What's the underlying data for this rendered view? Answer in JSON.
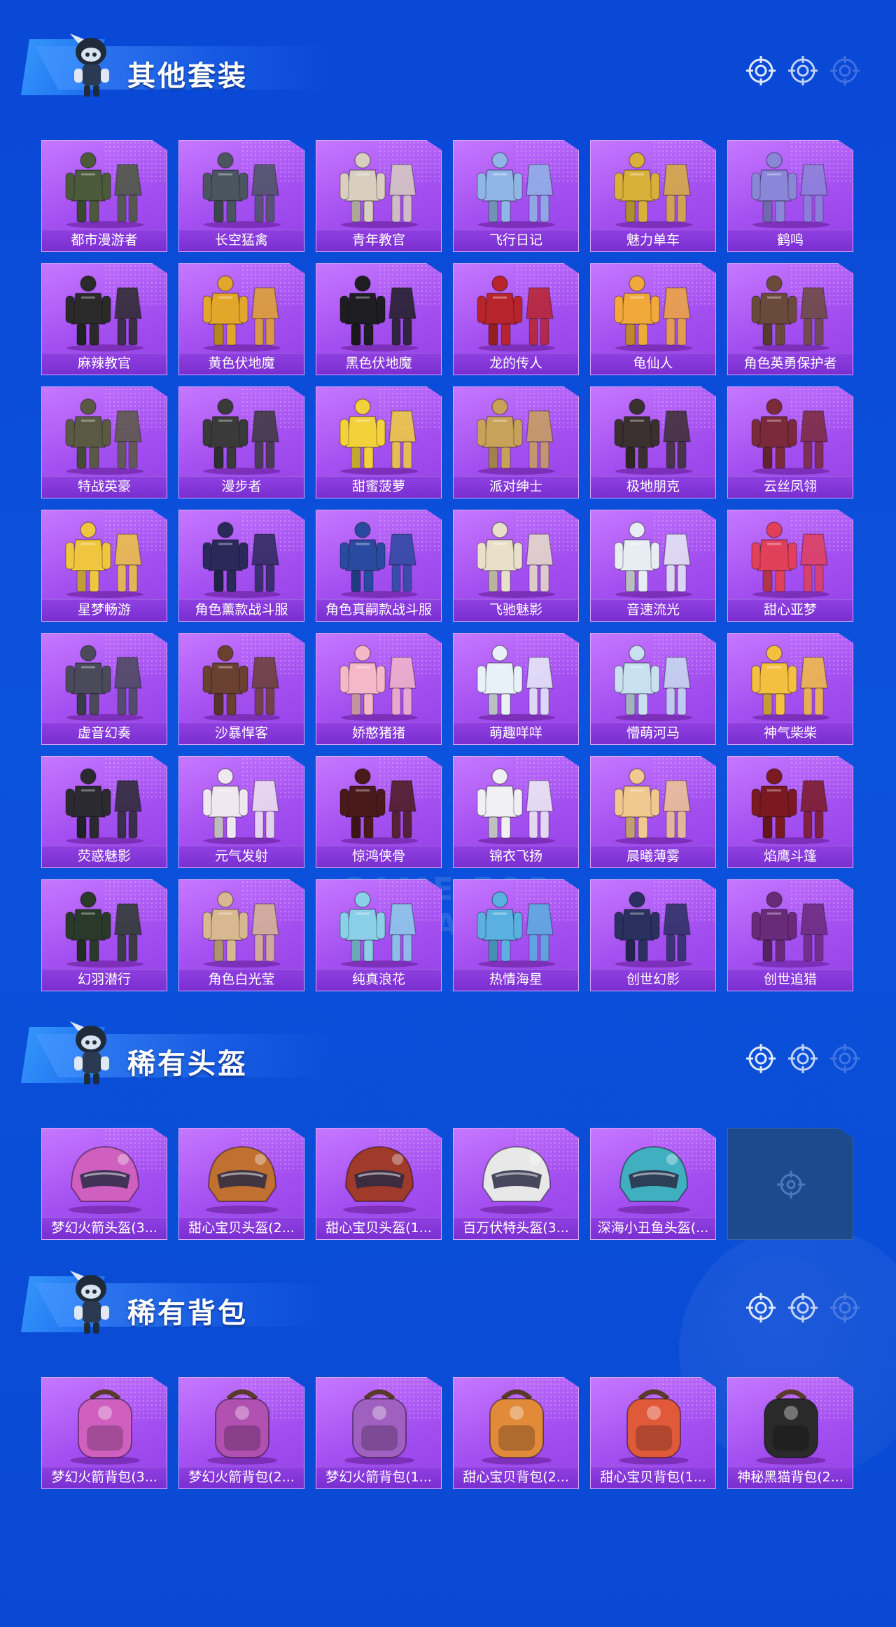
{
  "sections": [
    {
      "title": "其他套装",
      "items": [
        {
          "name": "都市漫游者",
          "kind": "outfit",
          "color": "#4a5a3a"
        },
        {
          "name": "长空猛禽",
          "kind": "outfit",
          "color": "#4b5560"
        },
        {
          "name": "青年教官",
          "kind": "outfit",
          "color": "#d8cfc0"
        },
        {
          "name": "飞行日记",
          "kind": "outfit",
          "color": "#8fb6e6"
        },
        {
          "name": "魅力单车",
          "kind": "outfit",
          "color": "#d9b13a"
        },
        {
          "name": "鹤鸣",
          "kind": "outfit",
          "color": "#8a86d8"
        },
        {
          "name": "麻辣教官",
          "kind": "outfit",
          "color": "#2a2a2a"
        },
        {
          "name": "黄色伏地魔",
          "kind": "outfit",
          "color": "#e2a62a"
        },
        {
          "name": "黑色伏地魔",
          "kind": "outfit",
          "color": "#1e1e22"
        },
        {
          "name": "龙的传人",
          "kind": "outfit",
          "color": "#b8242c"
        },
        {
          "name": "龟仙人",
          "kind": "outfit",
          "color": "#f0a93a"
        },
        {
          "name": "角色英勇保护者",
          "kind": "outfit",
          "color": "#6a4a3a"
        },
        {
          "name": "特战英豪",
          "kind": "outfit",
          "color": "#5a5a44"
        },
        {
          "name": "漫步者",
          "kind": "outfit",
          "color": "#3a3a3a"
        },
        {
          "name": "甜蜜菠萝",
          "kind": "outfit",
          "color": "#f2d13a"
        },
        {
          "name": "派对绅士",
          "kind": "outfit",
          "color": "#c9a25a"
        },
        {
          "name": "极地朋克",
          "kind": "outfit",
          "color": "#3a3030"
        },
        {
          "name": "云丝凤翎",
          "kind": "outfit",
          "color": "#7a2a3a"
        },
        {
          "name": "星梦畅游",
          "kind": "outfit",
          "color": "#f0c640"
        },
        {
          "name": "角色薰款战斗服",
          "kind": "outfit",
          "color": "#2a2a5a"
        },
        {
          "name": "角色真嗣款战斗服",
          "kind": "outfit",
          "color": "#2a4aa0"
        },
        {
          "name": "飞驰魅影",
          "kind": "outfit",
          "color": "#e8e0c8"
        },
        {
          "name": "音速流光",
          "kind": "outfit",
          "color": "#e6eef4"
        },
        {
          "name": "甜心亚梦",
          "kind": "outfit",
          "color": "#e0405a"
        },
        {
          "name": "虚音幻奏",
          "kind": "outfit",
          "color": "#4a4a5a"
        },
        {
          "name": "沙暴悍客",
          "kind": "outfit",
          "color": "#6a4030"
        },
        {
          "name": "娇憨猪猪",
          "kind": "outfit",
          "color": "#f4b8c8"
        },
        {
          "name": "萌趣咩咩",
          "kind": "outfit",
          "color": "#e8f0f8"
        },
        {
          "name": "懵萌河马",
          "kind": "outfit",
          "color": "#c8e0f0"
        },
        {
          "name": "神气柴柴",
          "kind": "outfit",
          "color": "#f4c040"
        },
        {
          "name": "荧惑魅影",
          "kind": "outfit",
          "color": "#2a2a30"
        },
        {
          "name": "元气发射",
          "kind": "outfit",
          "color": "#f0e8f0"
        },
        {
          "name": "惊鸿侠骨",
          "kind": "outfit",
          "color": "#4a1a1a"
        },
        {
          "name": "锦衣飞扬",
          "kind": "outfit",
          "color": "#f0f0f4"
        },
        {
          "name": "晨曦薄雾",
          "kind": "outfit",
          "color": "#f0c890"
        },
        {
          "name": "焰鹰斗篷",
          "kind": "outfit",
          "color": "#7a1a20"
        },
        {
          "name": "幻羽潜行",
          "kind": "outfit",
          "color": "#2a3a2a"
        },
        {
          "name": "角色白光莹",
          "kind": "outfit",
          "color": "#d8b890"
        },
        {
          "name": "纯真浪花",
          "kind": "outfit",
          "color": "#8ad0e8"
        },
        {
          "name": "热情海星",
          "kind": "outfit",
          "color": "#5ab0e0"
        },
        {
          "name": "创世幻影",
          "kind": "outfit",
          "color": "#2a3060"
        },
        {
          "name": "创世追猎",
          "kind": "outfit",
          "color": "#6a2a7a"
        }
      ]
    },
    {
      "title": "稀有头盔",
      "items": [
        {
          "name": "梦幻火箭头盔(3...",
          "kind": "helmet",
          "color": "#d060c0"
        },
        {
          "name": "甜心宝贝头盔(2...",
          "kind": "helmet",
          "color": "#c07030"
        },
        {
          "name": "甜心宝贝头盔(1...",
          "kind": "helmet",
          "color": "#a03a2a"
        },
        {
          "name": "百万伏特头盔(3...",
          "kind": "helmet",
          "color": "#e8e8e8"
        },
        {
          "name": "深海小丑鱼头盔(...",
          "kind": "helmet",
          "color": "#40b0c0"
        },
        {
          "name": "",
          "kind": "empty",
          "color": "#1d4a8c"
        }
      ]
    },
    {
      "title": "稀有背包",
      "items": [
        {
          "name": "梦幻火箭背包(3...",
          "kind": "backpack",
          "color": "#d060c0"
        },
        {
          "name": "梦幻火箭背包(2...",
          "kind": "backpack",
          "color": "#b050b0"
        },
        {
          "name": "梦幻火箭背包(1...",
          "kind": "backpack",
          "color": "#a060c0"
        },
        {
          "name": "甜心宝贝背包(2...",
          "kind": "backpack",
          "color": "#e08a3a"
        },
        {
          "name": "甜心宝贝背包(1...",
          "kind": "backpack",
          "color": "#e05a3a"
        },
        {
          "name": "神秘黑猫背包(2...",
          "kind": "backpack",
          "color": "#2a2a2a"
        }
      ]
    }
  ],
  "watermark": "GAME FOR PEACE",
  "icons": {
    "reticle": "reticle-icon",
    "mascot": "mascot-icon",
    "empty": "empty-slot-icon"
  }
}
